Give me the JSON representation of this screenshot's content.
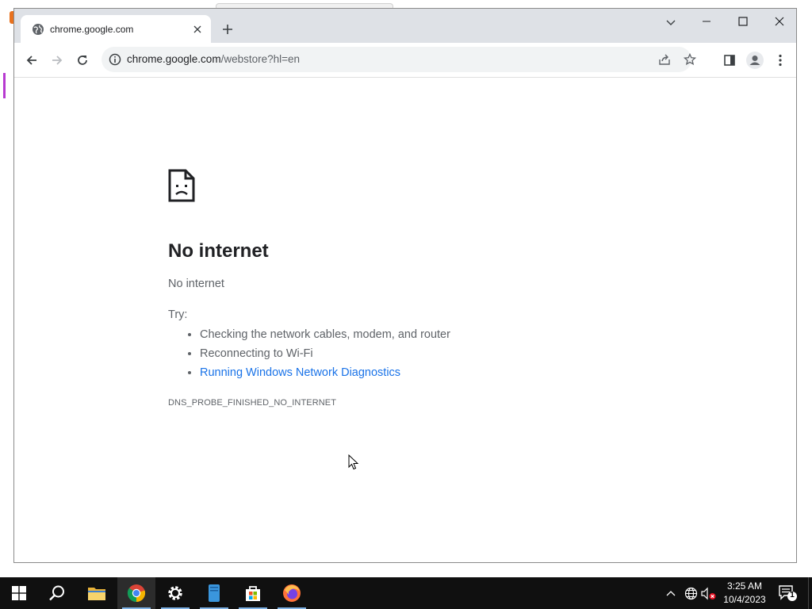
{
  "browser": {
    "tab_title": "chrome.google.com",
    "url_host": "chrome.google.com",
    "url_path": "/webstore?hl=en"
  },
  "error_page": {
    "heading": "No internet",
    "subtitle": "No internet",
    "try_label": "Try:",
    "suggestions": [
      "Checking the network cables, modem, and router",
      "Reconnecting to Wi-Fi",
      "Running Windows Network Diagnostics"
    ],
    "error_code": "DNS_PROBE_FINISHED_NO_INTERNET"
  },
  "taskbar": {
    "clock_time": "3:25 AM",
    "clock_date": "10/4/2023",
    "notification_count": "1",
    "apps": [
      "start-icon",
      "search-icon",
      "file-explorer-icon",
      "chrome-icon",
      "settings-icon",
      "notepad-icon",
      "store-icon",
      "firefox-icon"
    ]
  },
  "colors": {
    "link": "#1a73e8",
    "tab_strip": "#dee1e6",
    "taskbar": "#101010"
  }
}
